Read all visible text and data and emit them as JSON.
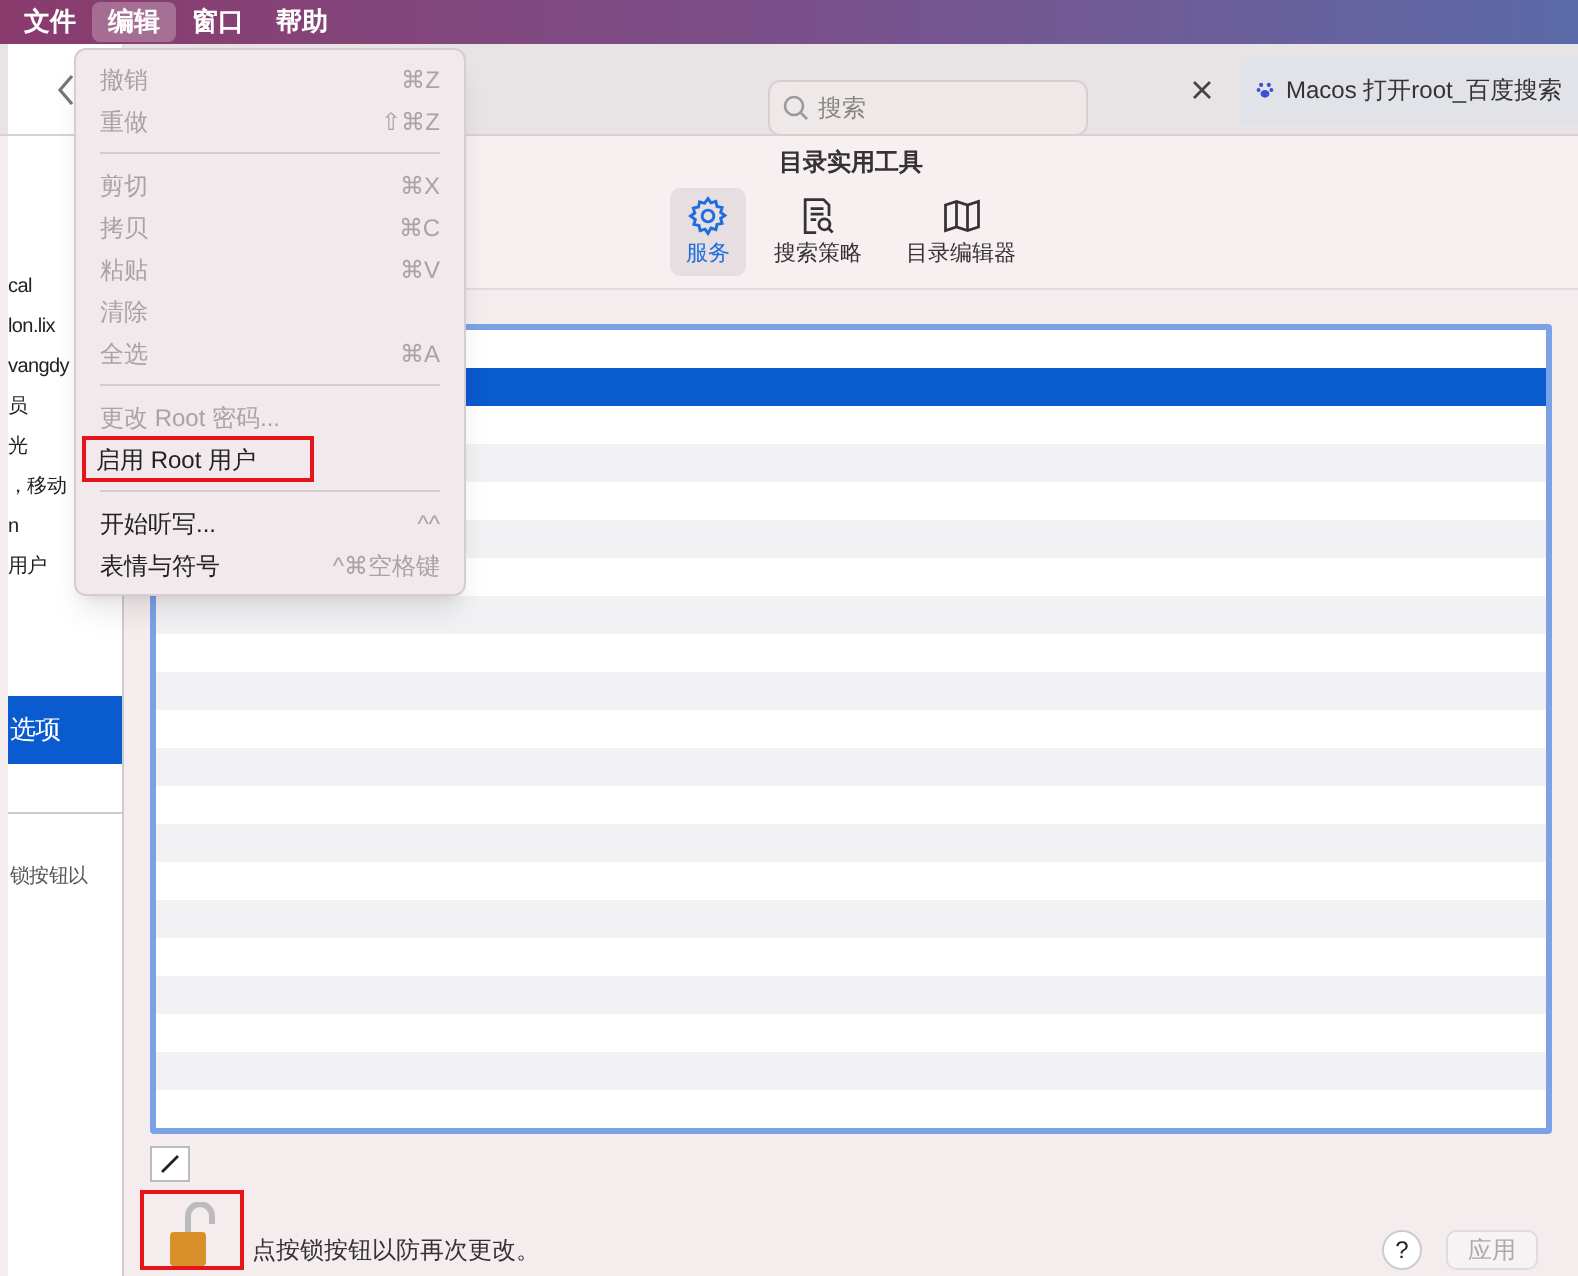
{
  "menu_bar": [
    {
      "label": "文件",
      "selected": false
    },
    {
      "label": "编辑",
      "selected": true
    },
    {
      "label": "窗口",
      "selected": false
    },
    {
      "label": "帮助",
      "selected": false
    }
  ],
  "menu": [
    {
      "kind": "item",
      "label": "撤销",
      "shortcut": "⌘Z",
      "disabled": true,
      "annotated": false
    },
    {
      "kind": "item",
      "label": "重做",
      "shortcut": "⇧⌘Z",
      "disabled": true,
      "annotated": false
    },
    {
      "kind": "separator"
    },
    {
      "kind": "item",
      "label": "剪切",
      "shortcut": "⌘X",
      "disabled": true,
      "annotated": false
    },
    {
      "kind": "item",
      "label": "拷贝",
      "shortcut": "⌘C",
      "disabled": true,
      "annotated": false
    },
    {
      "kind": "item",
      "label": "粘贴",
      "shortcut": "⌘V",
      "disabled": true,
      "annotated": false
    },
    {
      "kind": "item",
      "label": "清除",
      "disabled": true,
      "annotated": false
    },
    {
      "kind": "item",
      "label": "全选",
      "shortcut": "⌘A",
      "disabled": true,
      "annotated": false
    },
    {
      "kind": "separator"
    },
    {
      "kind": "item",
      "label": "更改 Root 密码...",
      "disabled": true,
      "annotated": false
    },
    {
      "kind": "item",
      "label": "启用 Root 用户",
      "disabled": false,
      "annotated": true
    },
    {
      "kind": "separator"
    },
    {
      "kind": "item",
      "label": "开始听写...",
      "shortcut": "^^",
      "disabled": false,
      "annotated": false
    },
    {
      "kind": "item",
      "label": "表情与符号",
      "shortcut": "^⌘空格键",
      "disabled": false,
      "annotated": false
    }
  ],
  "browser": {
    "search": {
      "placeholder": "搜索"
    },
    "tab": {
      "title": "Macos 打开root_百度搜索"
    }
  },
  "sidebar": {
    "items": [
      {
        "text": "cal",
        "selected": false
      },
      {
        "text": "lon.lix",
        "selected": false
      },
      {
        "text": "vangdy",
        "selected": false
      },
      {
        "text": "员",
        "selected": false
      },
      {
        "text": "光",
        "selected": false
      },
      {
        "text": "，移动",
        "selected": false
      },
      {
        "text": "n",
        "selected": false
      },
      {
        "text": "用户",
        "selected": false
      },
      {
        "text": "选项",
        "selected": true
      }
    ],
    "footer_text": "锁按钮以"
  },
  "window": {
    "title": "目录实用工具"
  },
  "toolbar": [
    {
      "label": "服务",
      "kind": "gear",
      "selected": true
    },
    {
      "label": "搜索策略",
      "kind": "document-search",
      "selected": false
    },
    {
      "label": "目录编辑器",
      "kind": "map",
      "selected": false
    }
  ],
  "list_rows": [
    {
      "selected": false
    },
    {
      "selected": true
    },
    {
      "selected": false
    },
    {
      "selected": false
    },
    {
      "selected": false
    },
    {
      "selected": false
    },
    {
      "selected": false
    },
    {
      "selected": false
    },
    {
      "selected": false
    },
    {
      "selected": false
    },
    {
      "selected": false
    },
    {
      "selected": false
    },
    {
      "selected": false
    },
    {
      "selected": false
    },
    {
      "selected": false
    },
    {
      "selected": false
    },
    {
      "selected": false
    },
    {
      "selected": false
    },
    {
      "selected": false
    },
    {
      "selected": false
    },
    {
      "selected": false
    }
  ],
  "lock": {
    "locked": false,
    "annotated": true,
    "text": "点按锁按钮以防再次更改。"
  },
  "buttons": {
    "help": "?",
    "apply": {
      "label": "应用",
      "disabled": true
    }
  }
}
